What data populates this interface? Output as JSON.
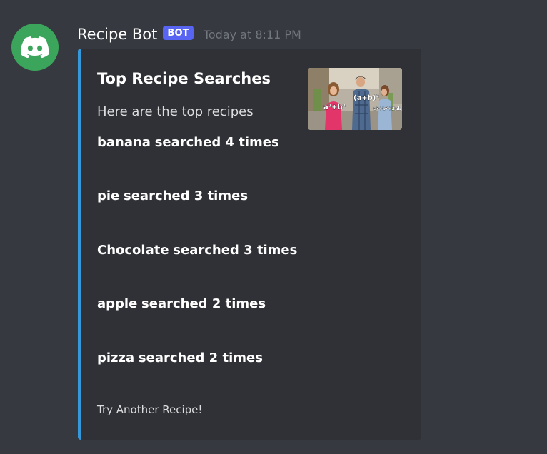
{
  "message": {
    "username": "Recipe Bot",
    "bot_tag": "BOT",
    "timestamp": "Today at 8:11 PM",
    "avatar_icon": "discord-logo-icon",
    "avatar_color": "#3ba55c"
  },
  "embed": {
    "accent_color": "#3498db",
    "title": "Top Recipe Searches",
    "description": "Here are the top recipes",
    "fields": [
      {
        "name": "banana",
        "value": "searched 4 times"
      },
      {
        "name": "pie",
        "value": "searched 3 times"
      },
      {
        "name": "Chocolate",
        "value": "searched 3 times"
      },
      {
        "name": "apple",
        "value": "searched 2 times"
      },
      {
        "name": "pizza",
        "value": "searched 2 times"
      }
    ],
    "footer": "Try Another Recipe!",
    "thumbnail": {
      "labels": [
        "a²+b²",
        "(a+b)²",
        "a²+b²+2ab"
      ]
    }
  }
}
